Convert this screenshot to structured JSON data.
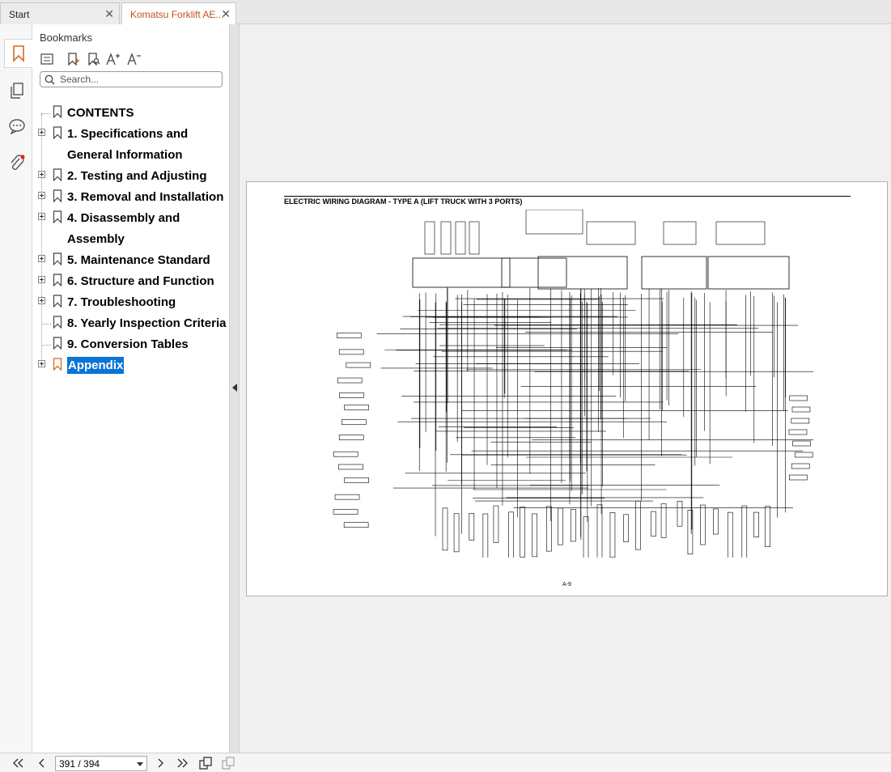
{
  "tabs": [
    {
      "label": "Start",
      "active": false
    },
    {
      "label": "Komatsu Forklift AE...",
      "active": true
    }
  ],
  "rail": {
    "items": [
      {
        "icon": "bookmark-icon",
        "active": true
      },
      {
        "icon": "pages-icon",
        "active": false
      },
      {
        "icon": "comments-icon",
        "active": false
      },
      {
        "icon": "attachment-icon",
        "active": false
      }
    ]
  },
  "panel": {
    "title": "Bookmarks",
    "search_placeholder": "Search...",
    "toolbar": [
      "outline-view-icon",
      "add-bookmark-icon",
      "find-bookmark-icon",
      "increase-font-icon",
      "decrease-font-icon"
    ]
  },
  "bookmarks": [
    {
      "label": "CONTENTS",
      "expandable": false,
      "selected": false
    },
    {
      "label": "1. Specifications and General Information",
      "expandable": true,
      "selected": false,
      "lines": 2
    },
    {
      "label": "2. Testing and Adjusting",
      "expandable": true,
      "selected": false
    },
    {
      "label": "3. Removal and Installation",
      "expandable": true,
      "selected": false
    },
    {
      "label": "4. Disassembly and Assembly",
      "expandable": true,
      "selected": false,
      "lines": 2
    },
    {
      "label": "5. Maintenance Standard",
      "expandable": true,
      "selected": false
    },
    {
      "label": "6. Structure and Function",
      "expandable": true,
      "selected": false
    },
    {
      "label": "7. Troubleshooting",
      "expandable": true,
      "selected": false
    },
    {
      "label": "8. Yearly Inspection Criteria",
      "expandable": false,
      "selected": false
    },
    {
      "label": "9. Conversion Tables",
      "expandable": false,
      "selected": false
    },
    {
      "label": "Appendix",
      "expandable": true,
      "selected": true
    }
  ],
  "document": {
    "page_title": "ELECTRIC WIRING DIAGRAM - TYPE A (LIFT TRUCK WITH 3 PORTS)",
    "page_number": "A-9"
  },
  "status": {
    "page_indicator": "391 / 394"
  },
  "colors": {
    "accent_tab": "#c4511d",
    "selection": "#0b74d6",
    "bookmark_active": "#d06a20"
  }
}
